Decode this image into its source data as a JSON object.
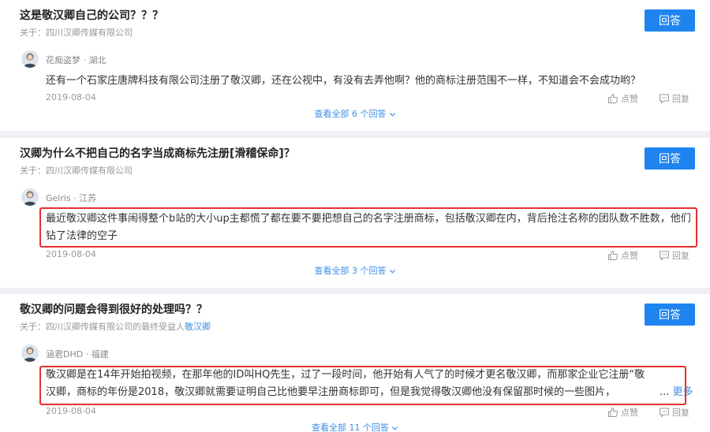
{
  "questions": [
    {
      "title": "这是敬汉卿自己的公司？？？",
      "about_prefix": "关于：",
      "about_text": "四川汉卿传媒有限公司",
      "about_link": "",
      "answer_button": "回答",
      "user": "花痴盗梦 · 湖北",
      "answer": "还有一个石家庄唐牌科技有限公司注册了敬汉卿，还在公视中，有没有去弄他啊？他的商标注册范围不一样，不知道会不会成功哟？",
      "date": "2019-08-04",
      "like_label": "点赞",
      "reply_label": "回复",
      "view_all": "查看全部 6 个回答"
    },
    {
      "title": "汉卿为什么不把自己的名字当成商标先注册[滑稽保命]？",
      "about_prefix": "关于：",
      "about_text": "四川汉卿传媒有限公司",
      "about_link": "",
      "answer_button": "回答",
      "user": "Gelris · 江苏",
      "answer": "最近敬汉卿这件事闹得整个b站的大小up主都慌了都在要不要把想自己的名字注册商标，包括敬汉卿在内，背后抢注名称的团队数不胜数，他们钻了法律的空子",
      "date": "2019-08-04",
      "like_label": "点赞",
      "reply_label": "回复",
      "view_all": "查看全部 3 个回答"
    },
    {
      "title": "敬汉卿的问题会得到很好的处理吗？？",
      "about_prefix": "关于：",
      "about_text": "四川汉卿传媒有限公司的最终受益人",
      "about_link": "敬汉卿",
      "answer_button": "回答",
      "user": "涵君DHD · 福建",
      "answer": "敬汉卿是在14年开始拍视频，在那年他的ID叫HQ先生，过了一段时间，他开始有人气了的时候才更名敬汉卿，而那家企业它注册“敬汉卿，商标的年份是2018，敬汉卿就需要证明自己比他要早注册商标即可，但是我觉得敬汉卿他没有保留那时候的一些图片，",
      "more_ellipsis": "...",
      "more_label": "更多",
      "date": "2019-08-04",
      "like_label": "点赞",
      "reply_label": "回复",
      "view_all": "查看全部 11 个回答"
    }
  ],
  "colors": {
    "accent": "#1e84f0",
    "link": "#3e8ee8",
    "highlight_box": "#e62e2e",
    "background": "#eef0f4"
  },
  "icons": [
    "user-avatar-icon",
    "thumbs-up-icon",
    "comment-icon",
    "chevron-down-icon"
  ]
}
